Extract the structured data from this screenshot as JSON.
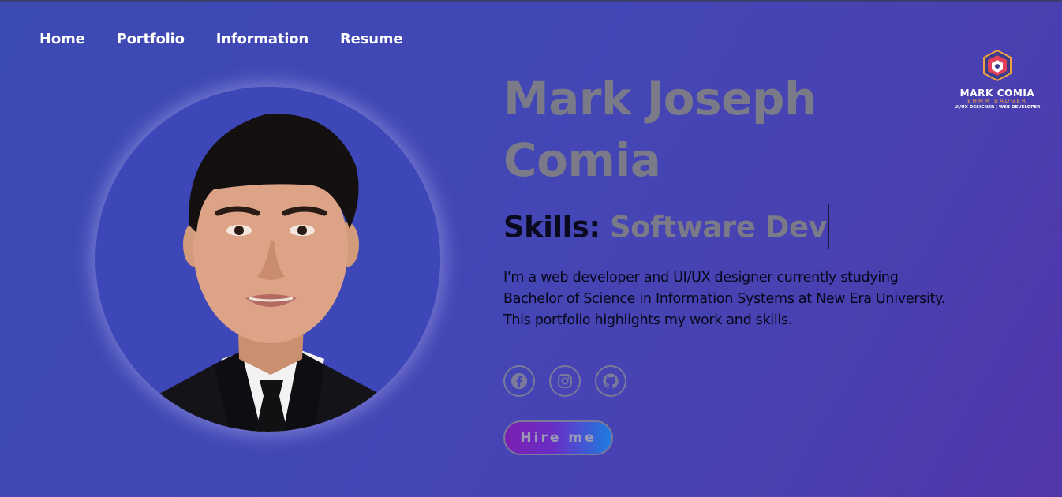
{
  "nav": {
    "items": [
      {
        "label": "Home"
      },
      {
        "label": "Portfolio"
      },
      {
        "label": "Information"
      },
      {
        "label": "Resume"
      }
    ]
  },
  "logo": {
    "title": "MARK COMIA",
    "subtitle": "EHMM BADGER",
    "tagline": "UI/UX DESIGNER | WEB DEVELOPER"
  },
  "hero": {
    "name_line1": "Mark Joseph",
    "name_line2": "Comia",
    "skills_label": "Skills:",
    "skills_value": "Software Dev",
    "bio_line1": "I'm a web developer and UI/UX designer currently studying",
    "bio_line2": "Bachelor of Science in Information Systems at New Era University.",
    "bio_line3": "This portfolio highlights my work and skills.",
    "hire_label": "Hire me"
  },
  "socials": [
    {
      "icon": "facebook-icon"
    },
    {
      "icon": "instagram-icon"
    },
    {
      "icon": "github-icon"
    }
  ],
  "colors": {
    "background": "#4347b6",
    "name_text": "#7a7a88",
    "hire_gradient_start": "#7a1fb2",
    "hire_gradient_end": "#1e7ce0"
  }
}
